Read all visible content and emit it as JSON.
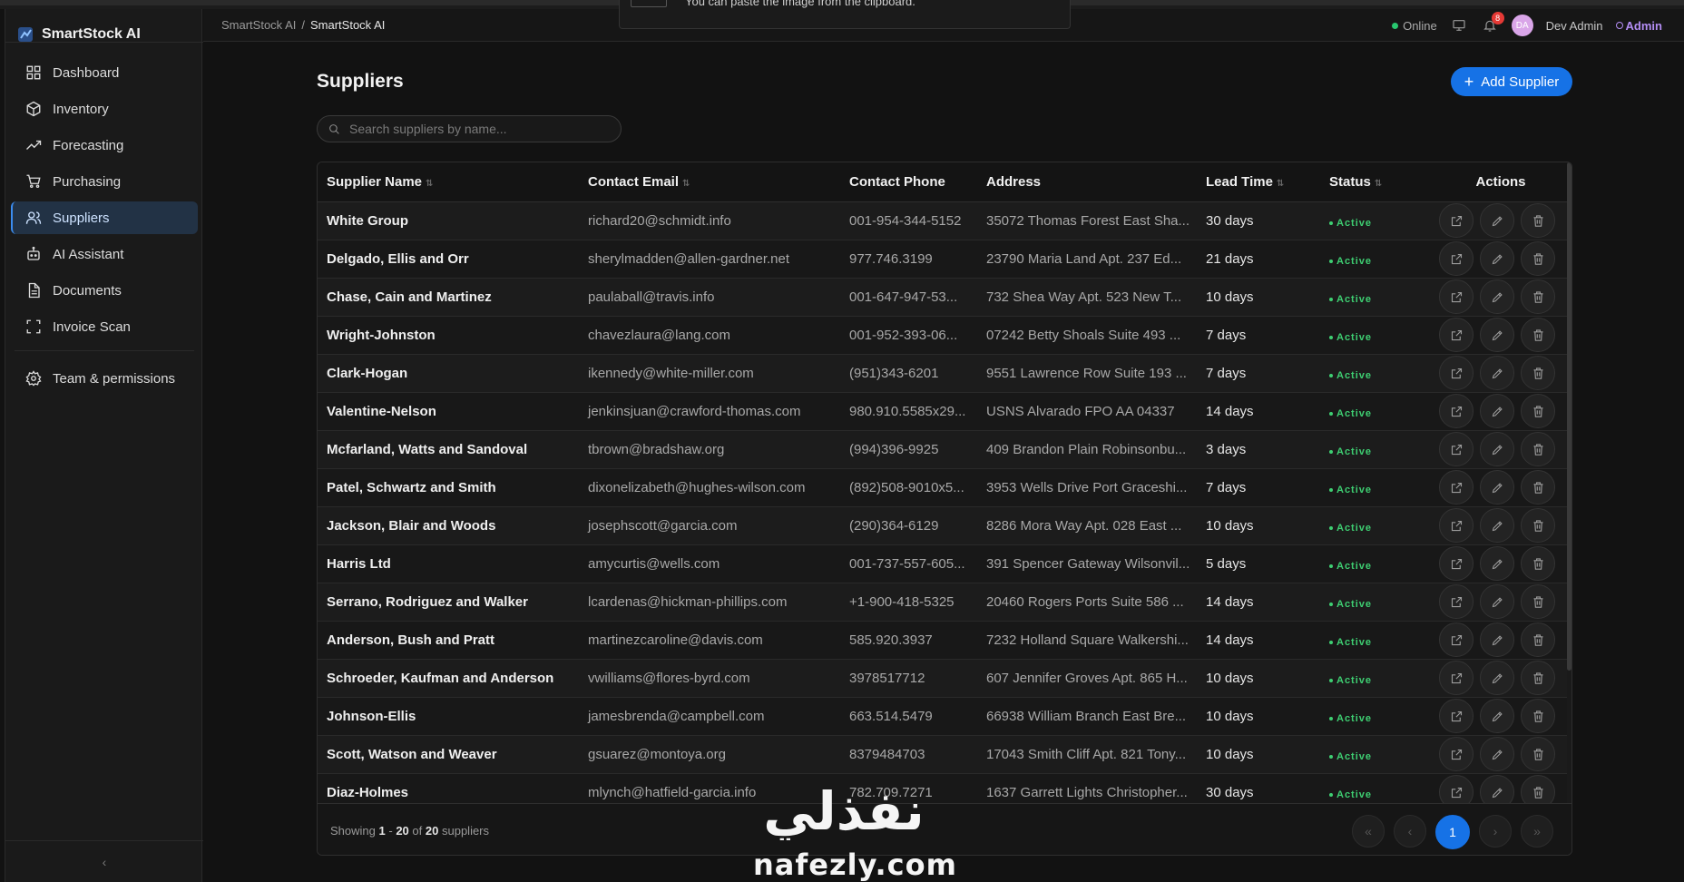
{
  "app": {
    "name": "SmartStock AI"
  },
  "toast": {
    "message": "You can paste the image from the clipboard."
  },
  "sidebar": {
    "items": [
      {
        "label": "Dashboard",
        "icon": "dashboard-icon"
      },
      {
        "label": "Inventory",
        "icon": "box-icon"
      },
      {
        "label": "Forecasting",
        "icon": "trend-icon"
      },
      {
        "label": "Purchasing",
        "icon": "cart-icon"
      },
      {
        "label": "Suppliers",
        "icon": "users-icon",
        "active": true
      },
      {
        "label": "AI Assistant",
        "icon": "bot-icon"
      },
      {
        "label": "Documents",
        "icon": "document-icon"
      },
      {
        "label": "Invoice Scan",
        "icon": "scan-icon"
      }
    ],
    "secondary": [
      {
        "label": "Team & permissions",
        "icon": "gear-icon"
      }
    ],
    "collapse": "‹"
  },
  "header": {
    "breadcrumb": [
      "SmartStock AI",
      "SmartStock AI"
    ],
    "status": "Online",
    "notifications": "8",
    "avatar_initials": "DA",
    "user": "Dev Admin",
    "role": "Admin"
  },
  "page": {
    "title": "Suppliers",
    "add_button": "Add Supplier",
    "search_placeholder": "Search suppliers by name..."
  },
  "table": {
    "columns": [
      "Supplier Name",
      "Contact Email",
      "Contact Phone",
      "Address",
      "Lead Time",
      "Status",
      "Actions"
    ],
    "rows": [
      [
        "White Group",
        "richard20@schmidt.info",
        "001-954-344-5152",
        "35072 Thomas Forest East Sha...",
        "30 days",
        "Active"
      ],
      [
        "Delgado, Ellis and Orr",
        "sherylmadden@allen-gardner.net",
        "977.746.3199",
        "23790 Maria Land Apt. 237 Ed...",
        "21 days",
        "Active"
      ],
      [
        "Chase, Cain and Martinez",
        "paulaball@travis.info",
        "001-647-947-53...",
        "732 Shea Way Apt. 523 New T...",
        "10 days",
        "Active"
      ],
      [
        "Wright-Johnston",
        "chavezlaura@lang.com",
        "001-952-393-06...",
        "07242 Betty Shoals Suite 493 ...",
        "7 days",
        "Active"
      ],
      [
        "Clark-Hogan",
        "ikennedy@white-miller.com",
        "(951)343-6201",
        "9551 Lawrence Row Suite 193 ...",
        "7 days",
        "Active"
      ],
      [
        "Valentine-Nelson",
        "jenkinsjuan@crawford-thomas.com",
        "980.910.5585x29...",
        "USNS Alvarado FPO AA 04337",
        "14 days",
        "Active"
      ],
      [
        "Mcfarland, Watts and Sandoval",
        "tbrown@bradshaw.org",
        "(994)396-9925",
        "409 Brandon Plain Robinsonbu...",
        "3 days",
        "Active"
      ],
      [
        "Patel, Schwartz and Smith",
        "dixonelizabeth@hughes-wilson.com",
        "(892)508-9010x5...",
        "3953 Wells Drive Port Graceshi...",
        "7 days",
        "Active"
      ],
      [
        "Jackson, Blair and Woods",
        "josephscott@garcia.com",
        "(290)364-6129",
        "8286 Mora Way Apt. 028 East ...",
        "10 days",
        "Active"
      ],
      [
        "Harris Ltd",
        "amycurtis@wells.com",
        "001-737-557-605...",
        "391 Spencer Gateway Wilsonvil...",
        "5 days",
        "Active"
      ],
      [
        "Serrano, Rodriguez and Walker",
        "lcardenas@hickman-phillips.com",
        "+1-900-418-5325",
        "20460 Rogers Ports Suite 586 ...",
        "14 days",
        "Active"
      ],
      [
        "Anderson, Bush and Pratt",
        "martinezcaroline@davis.com",
        "585.920.3937",
        "7232 Holland Square Walkershi...",
        "14 days",
        "Active"
      ],
      [
        "Schroeder, Kaufman and Anderson",
        "vwilliams@flores-byrd.com",
        "3978517712",
        "607 Jennifer Groves Apt. 865 H...",
        "10 days",
        "Active"
      ],
      [
        "Johnson-Ellis",
        "jamesbrenda@campbell.com",
        "663.514.5479",
        "66938 William Branch East Bre...",
        "10 days",
        "Active"
      ],
      [
        "Scott, Watson and Weaver",
        "gsuarez@montoya.org",
        "8379484703",
        "17043 Smith Cliff Apt. 821 Tony...",
        "10 days",
        "Active"
      ],
      [
        "Diaz-Holmes",
        "mlynch@hatfield-garcia.info",
        "782.709.7271",
        "1637 Garrett Lights Christopher...",
        "30 days",
        "Active"
      ]
    ]
  },
  "footer": {
    "showing_prefix": "Showing",
    "range_start": "1",
    "range_sep": "-",
    "range_end": "20",
    "of": "of",
    "total": "20",
    "suffix": "suppliers",
    "pages": {
      "first": "«",
      "prev": "‹",
      "current": "1",
      "next": "›",
      "last": "»"
    }
  },
  "watermark": {
    "arabic": "نفذلي",
    "latin": "nafezly.com"
  },
  "colors": {
    "accent": "#1672e6",
    "active": "#3ecf72",
    "role": "#b48ef5",
    "badge": "#e53935"
  }
}
